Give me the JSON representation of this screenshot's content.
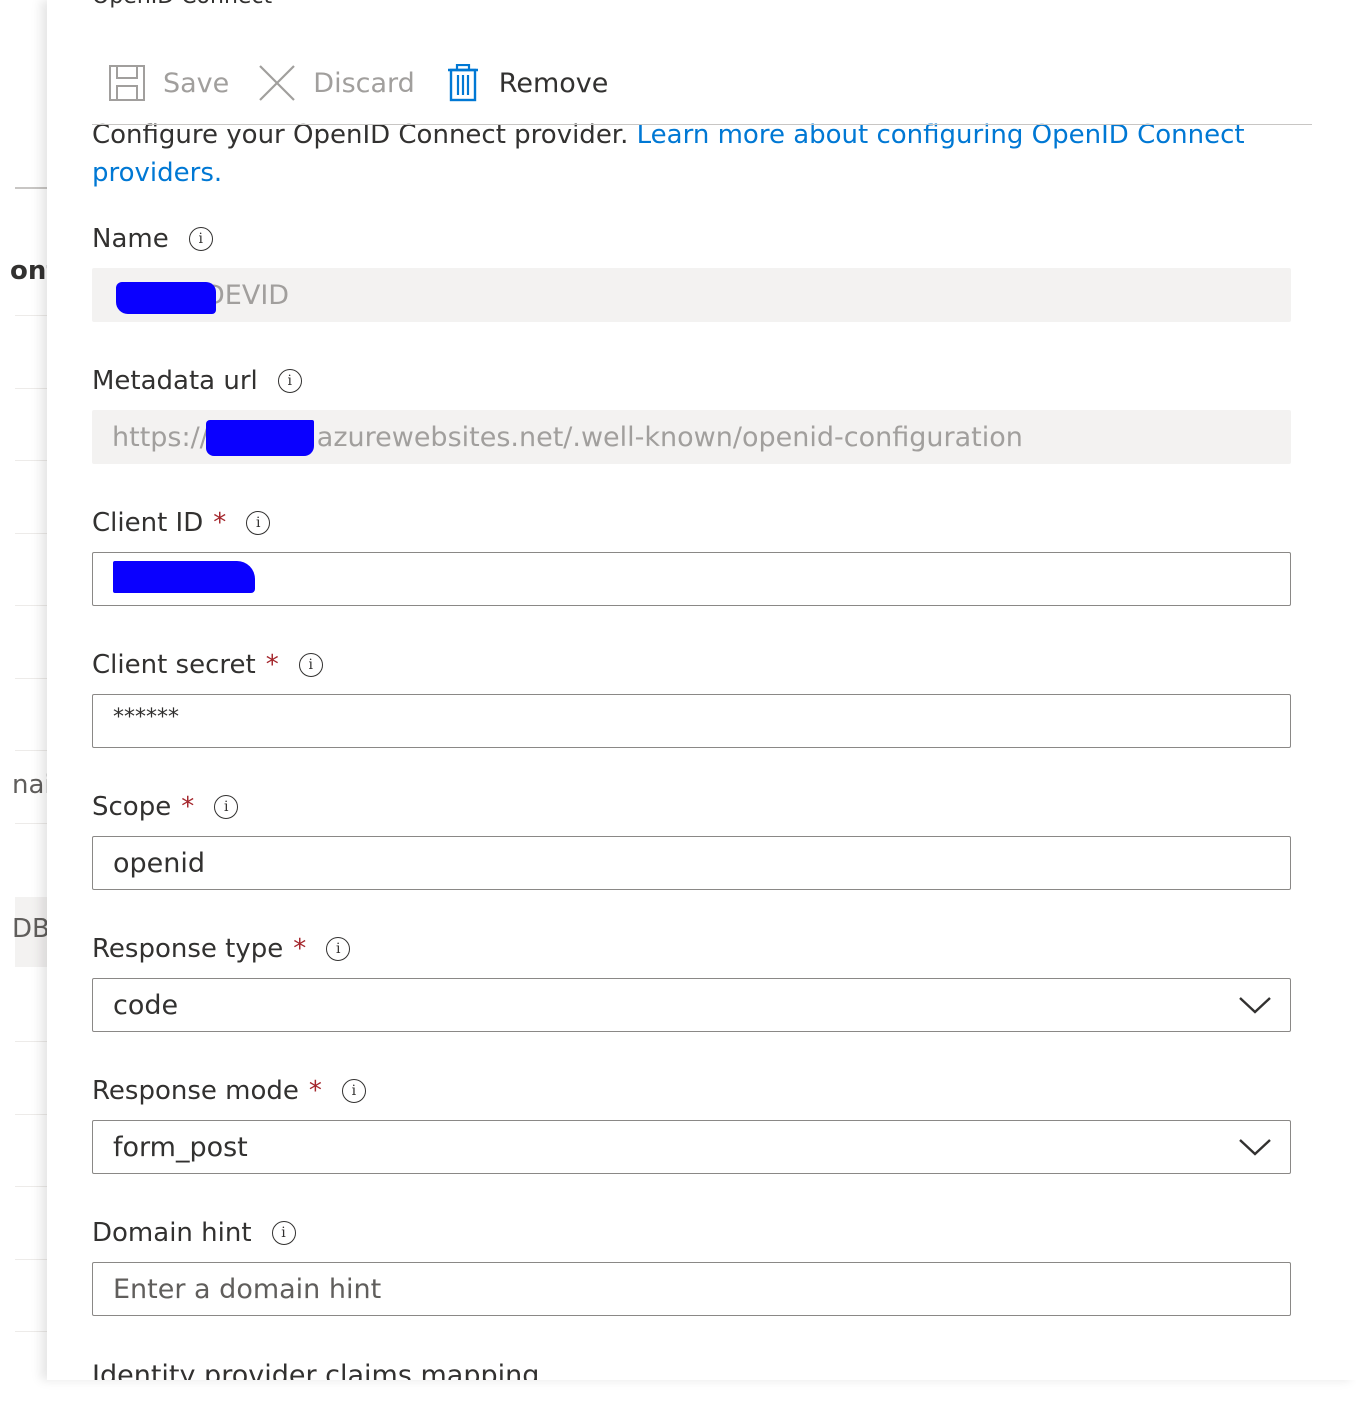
{
  "background": {
    "labels": [
      "onf",
      "nai",
      "DBI"
    ]
  },
  "panel": {
    "title": "OpenID Connect",
    "toolbar": {
      "save_label": "Save",
      "discard_label": "Discard",
      "remove_label": "Remove"
    },
    "intro": {
      "text": "Configure your OpenID Connect provider. ",
      "link": "Learn more about configuring OpenID Connect providers."
    },
    "fields": {
      "name": {
        "label": "Name",
        "value": "DEVID"
      },
      "metadata_url": {
        "label": "Metadata url",
        "value_prefix": "https://",
        "value_suffix": "azurewebsites.net/.well-known/openid-configuration"
      },
      "client_id": {
        "label": "Client ID",
        "required": "*",
        "value": ""
      },
      "client_secret": {
        "label": "Client secret",
        "required": "*",
        "value": "******"
      },
      "scope": {
        "label": "Scope",
        "required": "*",
        "value": "openid"
      },
      "response_type": {
        "label": "Response type",
        "required": "*",
        "value": "code"
      },
      "response_mode": {
        "label": "Response mode",
        "required": "*",
        "value": "form_post"
      },
      "domain_hint": {
        "label": "Domain hint",
        "placeholder": "Enter a domain hint"
      }
    },
    "next_section": "Identity provider claims mapping",
    "info_glyph": "i"
  },
  "colors": {
    "link": "#0078d4",
    "required": "#a4262c",
    "redaction": "#0a00ff"
  },
  "icons": [
    "save-icon",
    "discard-icon",
    "trash-icon",
    "info-icon",
    "chevron-down-icon"
  ]
}
